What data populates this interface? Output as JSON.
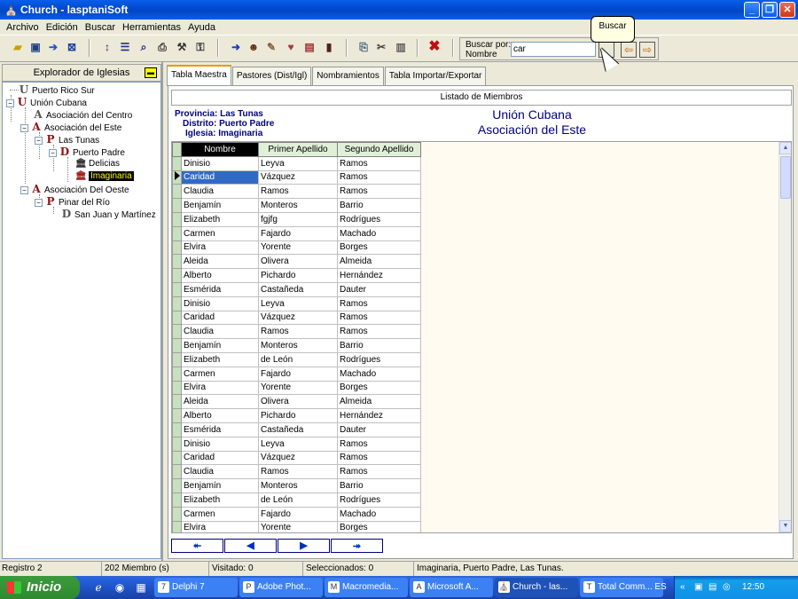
{
  "window": {
    "title": "Church - lasptaniSoft",
    "icon": "church-icon"
  },
  "menu": [
    "Archivo",
    "Edición",
    "Buscar",
    "Herramientas",
    "Ayuda"
  ],
  "toolbar": {
    "search_label_1": "Buscar por:",
    "search_label_2": "Nombre",
    "search_value": "car",
    "tooltip": "Buscar"
  },
  "explorer": {
    "title": "Explorador de Iglesias",
    "nodes": [
      "Puerto Rico Sur",
      "Unión Cubana",
      "Asociación del Centro",
      "Asociación del Este",
      "Las Tunas",
      "Puerto Padre",
      "Delicias",
      "Imaginaria",
      "Asociación Del Oeste",
      "Pinar del Río",
      "San Juan y Martínez"
    ],
    "selected": "Imaginaria"
  },
  "tabs": [
    "Tabla Maestra",
    "Pastores (Dist/Igl)",
    "Nombramientos",
    "Tabla Importar/Exportar"
  ],
  "main": {
    "list_title": "Listado de Miembros",
    "provincia": "Provincia: Las Tunas",
    "distrito": "Distrito: Puerto Padre",
    "iglesia": "Iglesia: Imaginaria",
    "union": "Unión Cubana",
    "asociacion": "Asociación del Este"
  },
  "grid": {
    "columns": [
      "Nombre",
      "Primer Apellido",
      "Segundo Apellido"
    ],
    "current_row": 1,
    "rows": [
      [
        "Dinisio",
        "Leyva",
        "Ramos"
      ],
      [
        "Caridad",
        "Vázquez",
        "Ramos"
      ],
      [
        "Claudia",
        "Ramos",
        "Ramos"
      ],
      [
        "Benjamín",
        "Monteros",
        "Barrio"
      ],
      [
        "Elizabeth",
        "fgjfg",
        "Rodrígues"
      ],
      [
        "Carmen",
        "Fajardo",
        "Machado"
      ],
      [
        "Elvira",
        "Yorente",
        "Borges"
      ],
      [
        "Aleida",
        "Olivera",
        "Almeida"
      ],
      [
        "Alberto",
        "Pichardo",
        "Hernández"
      ],
      [
        "Esmérida",
        "Castañeda",
        "Dauter"
      ],
      [
        "Dinisio",
        "Leyva",
        "Ramos"
      ],
      [
        "Caridad",
        "Vázquez",
        "Ramos"
      ],
      [
        "Claudia",
        "Ramos",
        "Ramos"
      ],
      [
        "Benjamín",
        "Monteros",
        "Barrio"
      ],
      [
        "Elizabeth",
        "de León",
        "Rodrígues"
      ],
      [
        "Carmen",
        "Fajardo",
        "Machado"
      ],
      [
        "Elvira",
        "Yorente",
        "Borges"
      ],
      [
        "Aleida",
        "Olivera",
        "Almeida"
      ],
      [
        "Alberto",
        "Pichardo",
        "Hernández"
      ],
      [
        "Esmérida",
        "Castañeda",
        "Dauter"
      ],
      [
        "Dinisio",
        "Leyva",
        "Ramos"
      ],
      [
        "Caridad",
        "Vázquez",
        "Ramos"
      ],
      [
        "Claudia",
        "Ramos",
        "Ramos"
      ],
      [
        "Benjamín",
        "Monteros",
        "Barrio"
      ],
      [
        "Elizabeth",
        "de León",
        "Rodrígues"
      ],
      [
        "Carmen",
        "Fajardo",
        "Machado"
      ],
      [
        "Elvira",
        "Yorente",
        "Borges"
      ]
    ]
  },
  "status": {
    "registro": "Registro 2",
    "miembros": "202 Miembro (s)",
    "visitado": "Visitado: 0",
    "seleccionados": "Seleccionados: 0",
    "location": "Imaginaria, Puerto Padre, Las Tunas."
  },
  "taskbar": {
    "start": "Inicio",
    "tasks": [
      "Delphi 7",
      "Adobe Phot...",
      "Macromedia...",
      "Microsoft A...",
      "Church - las...",
      "Total Comm..."
    ],
    "active_task": "Church - las...",
    "language": "ES",
    "clock": "12:50"
  },
  "colors": {
    "titlebar": "#0049cf",
    "selection": "#316ac5",
    "tree_selected_bg": "#000000",
    "tree_selected_fg": "#ffff00",
    "info_text": "#000080"
  }
}
